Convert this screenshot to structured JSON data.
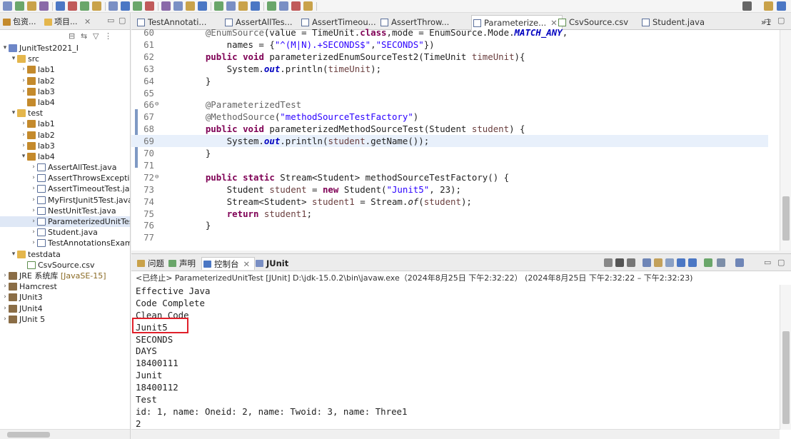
{
  "toolbar": {},
  "left_panel": {
    "tabs": [
      {
        "label": "包资..."
      },
      {
        "label": "项目..."
      }
    ],
    "tree": [
      {
        "label": "JunitTest2021_I",
        "level": 0,
        "arrow": "▾",
        "icon": "project"
      },
      {
        "label": "src",
        "level": 1,
        "arrow": "▾",
        "icon": "folder"
      },
      {
        "label": "lab1",
        "level": 2,
        "arrow": "›",
        "icon": "pkg"
      },
      {
        "label": "lab2",
        "level": 2,
        "arrow": "›",
        "icon": "pkg"
      },
      {
        "label": "lab3",
        "level": 2,
        "arrow": "›",
        "icon": "pkg"
      },
      {
        "label": "lab4",
        "level": 2,
        "arrow": "",
        "icon": "pkg"
      },
      {
        "label": "test",
        "level": 1,
        "arrow": "▾",
        "icon": "folder"
      },
      {
        "label": "lab1",
        "level": 2,
        "arrow": "›",
        "icon": "pkg"
      },
      {
        "label": "lab2",
        "level": 2,
        "arrow": "›",
        "icon": "pkg"
      },
      {
        "label": "lab3",
        "level": 2,
        "arrow": "›",
        "icon": "pkg"
      },
      {
        "label": "lab4",
        "level": 2,
        "arrow": "▾",
        "icon": "pkg"
      },
      {
        "label": "AssertAllTest.java",
        "level": 3,
        "arrow": "›",
        "icon": "java"
      },
      {
        "label": "AssertThrowsExceptionTest.java",
        "level": 3,
        "arrow": "›",
        "icon": "java"
      },
      {
        "label": "AssertTimeoutTest.java",
        "level": 3,
        "arrow": "›",
        "icon": "java"
      },
      {
        "label": "MyFirstJunit5Test.java",
        "level": 3,
        "arrow": "›",
        "icon": "java"
      },
      {
        "label": "NestUnitTest.java",
        "level": 3,
        "arrow": "›",
        "icon": "java"
      },
      {
        "label": "ParameterizedUnitTest.java",
        "level": 3,
        "arrow": "›",
        "icon": "java",
        "selected": true
      },
      {
        "label": "Student.java",
        "level": 3,
        "arrow": "›",
        "icon": "java"
      },
      {
        "label": "TestAnnotationsExample.java",
        "level": 3,
        "arrow": "›",
        "icon": "java"
      },
      {
        "label": "testdata",
        "level": 1,
        "arrow": "▾",
        "icon": "folder"
      },
      {
        "label": "CsvSource.csv",
        "level": 2,
        "arrow": "",
        "icon": "csv"
      },
      {
        "label": "JRE 系统库",
        "suffix": "[JavaSE-15]",
        "level": 0,
        "arrow": "›",
        "icon": "lib"
      },
      {
        "label": "Hamcrest",
        "level": 0,
        "arrow": "›",
        "icon": "lib"
      },
      {
        "label": "JUnit3",
        "level": 0,
        "arrow": "›",
        "icon": "lib"
      },
      {
        "label": "JUnit4",
        "level": 0,
        "arrow": "›",
        "icon": "lib"
      },
      {
        "label": "JUnit 5",
        "level": 0,
        "arrow": "›",
        "icon": "lib"
      }
    ]
  },
  "editor": {
    "tabs": [
      {
        "label": "TestAnnotati...",
        "active": false
      },
      {
        "label": "AssertAllTes...",
        "active": false
      },
      {
        "label": "AssertTimeou...",
        "active": false
      },
      {
        "label": "AssertThrow...",
        "active": false
      },
      {
        "label": "Parameterize...",
        "active": true
      },
      {
        "label": "CsvSource.csv",
        "active": false
      },
      {
        "label": "Student.java",
        "active": false
      }
    ],
    "overflow_label": "»1",
    "lines": [
      {
        "num": "60",
        "fold": "",
        "html": "    <span class=\"ann\">@EnumSource</span>(value = TimeUnit.<span class=\"kw\">class</span>,mode = EnumSource.Mode.<span class=\"fld\">MATCH_ANY</span>,"
      },
      {
        "num": "61",
        "fold": "",
        "html": "        names = {<span class=\"str\">\"^(M|N).+SECONDS$\"</span>,<span class=\"str\">\"SECONDS\"</span>})"
      },
      {
        "num": "62",
        "fold": "",
        "html": "    <span class=\"kw\">public</span> <span class=\"kw\">void</span> parameterizedEnumSourceTest2(TimeUnit <span class=\"var\">timeUnit</span>){"
      },
      {
        "num": "63",
        "fold": "",
        "html": "        System.<span class=\"fld\">out</span>.println(<span class=\"var\">timeUnit</span>);"
      },
      {
        "num": "64",
        "fold": "",
        "html": "    }"
      },
      {
        "num": "65",
        "fold": "",
        "html": ""
      },
      {
        "num": "66",
        "fold": "⊖",
        "html": "    <span class=\"ann\">@ParameterizedTest</span>"
      },
      {
        "num": "67",
        "fold": "",
        "html": "    <span class=\"ann\">@MethodSource</span>(<span class=\"str\">\"methodSourceTestFactory\"</span>)"
      },
      {
        "num": "68",
        "fold": "",
        "html": "    <span class=\"kw\">public</span> <span class=\"kw\">void</span> parameterizedMethodSourceTest(Student <span class=\"var\">student</span>) {"
      },
      {
        "num": "69",
        "fold": "",
        "html": "        System.<span class=\"fld\">out</span>.println(<span class=\"var\">student</span>.getName());",
        "highlight": true
      },
      {
        "num": "70",
        "fold": "",
        "html": "    }"
      },
      {
        "num": "71",
        "fold": "",
        "html": ""
      },
      {
        "num": "72",
        "fold": "⊖",
        "html": "    <span class=\"kw\">public</span> <span class=\"kw\">static</span> Stream&lt;Student&gt; methodSourceTestFactory() {"
      },
      {
        "num": "73",
        "fold": "",
        "html": "        Student <span class=\"var\">student</span> = <span class=\"kw\">new</span> Student(<span class=\"str\">\"Junit5\"</span>, 23);"
      },
      {
        "num": "74",
        "fold": "",
        "html": "        Stream&lt;Student&gt; <span class=\"var\">student1</span> = Stream.<span class=\"ital\">of</span>(<span class=\"var\">student</span>);"
      },
      {
        "num": "75",
        "fold": "",
        "html": "        <span class=\"kw\">return</span> <span class=\"var\">student1</span>;"
      },
      {
        "num": "76",
        "fold": "",
        "html": "    }"
      },
      {
        "num": "77",
        "fold": "",
        "html": ""
      }
    ]
  },
  "console": {
    "tabs": [
      {
        "label": "问题",
        "active": false
      },
      {
        "label": "声明",
        "active": false
      },
      {
        "label": "控制台",
        "active": true
      },
      {
        "label": "JUnit",
        "active": false
      }
    ],
    "status": "<已终止> ParameterizedUnitTest [JUnit] D:\\jdk-15.0.2\\bin\\javaw.exe（2024年8月25日 下午2:32:22） (2024年8月25日 下午2:32:22 – 下午2:32:23)",
    "output": [
      "Effective Java",
      "Code Complete",
      "Clean Code",
      "Junit5",
      "SECONDS",
      "DAYS",
      "18400111",
      "Junit",
      "18400112",
      "Test",
      "id: 1, name: Oneid: 2, name: Twoid: 3, name: Three1",
      "2"
    ]
  },
  "colors": {
    "keyword": "#7f0055",
    "string": "#2a00ff",
    "annotation": "#646464",
    "highlight_box": "#e0202a"
  }
}
